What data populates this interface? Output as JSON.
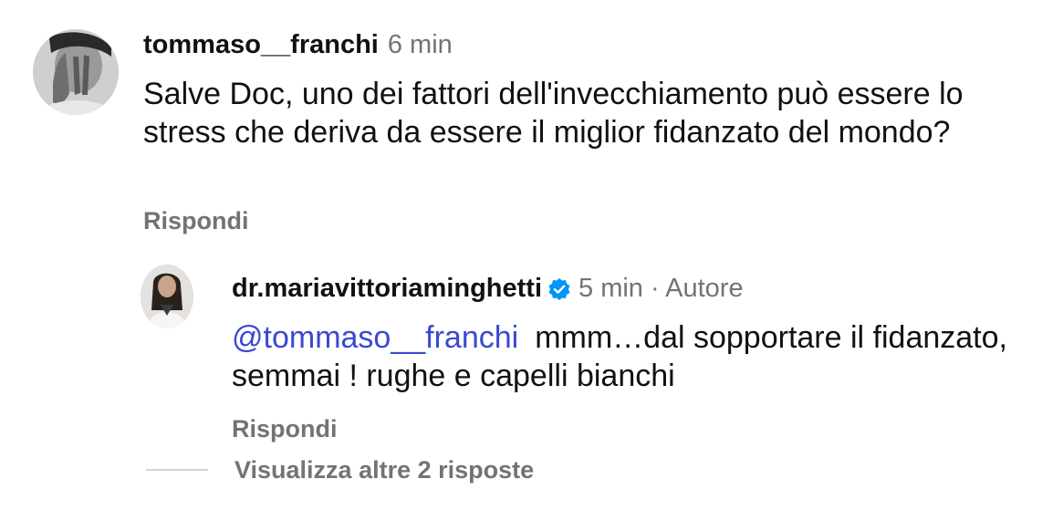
{
  "comment": {
    "username": "tommaso__franchi",
    "time": "6 min",
    "text": "Salve Doc, uno dei fattori dell'invecchiamento può essere lo stress che deriva da essere il miglior fidanzato del mondo?",
    "reply_label": "Rispondi"
  },
  "reply": {
    "username": "dr.mariavittoriaminghetti",
    "verified": true,
    "time": "5 min",
    "separator": "·",
    "author_badge": "Autore",
    "mention": "@tommaso__franchi",
    "text": "mmm…dal sopportare il fidanzato, semmai ! rughe e capelli bianchi",
    "reply_label": "Rispondi"
  },
  "view_more_label": "Visualizza altre 2 risposte",
  "colors": {
    "text": "#111111",
    "muted": "#737373",
    "mention": "#3949d1",
    "verified": "#0095f6"
  },
  "icons": {
    "verified": "verified-badge-icon"
  }
}
